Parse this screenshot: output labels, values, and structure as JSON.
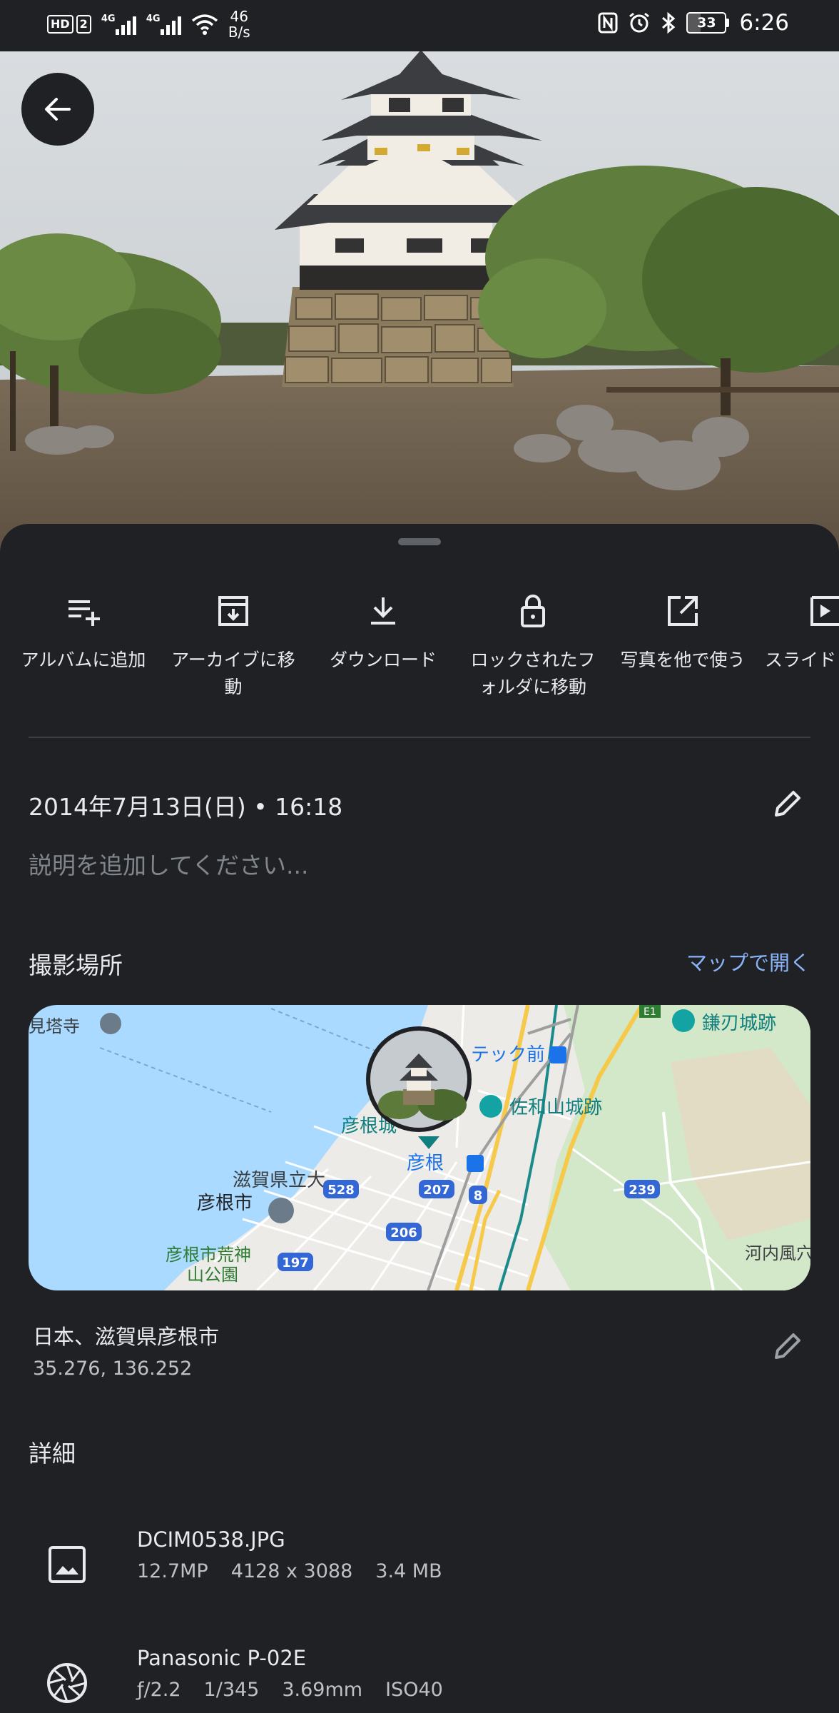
{
  "status_bar": {
    "hd_label": "HD",
    "sim_label": "2",
    "signal1_label": "4G",
    "signal2_label": "4G",
    "speed_value": "46",
    "speed_unit": "B/s",
    "battery": "33",
    "battery_level": 0.33,
    "time": "6:26"
  },
  "back_button": {
    "icon": "arrow-left-icon"
  },
  "actions": [
    {
      "label": "アルバムに追加",
      "icon": "playlist-add-icon"
    },
    {
      "label": "アーカイブに移\n動",
      "icon": "archive-icon"
    },
    {
      "label": "ダウンロード",
      "icon": "download-icon"
    },
    {
      "label": "ロックされたフ\nォルダに移動",
      "icon": "lock-icon"
    },
    {
      "label": "写真を他で使う",
      "icon": "open-external-icon"
    },
    {
      "label": "スライド",
      "icon": "slideshow-icon"
    }
  ],
  "info": {
    "datetime": "2014年7月13日(日) • 16:18",
    "description_placeholder": "説明を追加してください..."
  },
  "location": {
    "title": "撮影場所",
    "open_map": "マップで開く",
    "place": "日本、滋賀県彦根市",
    "coords": "35.276, 136.252"
  },
  "map": {
    "labels": {
      "temple": "見塔寺",
      "station_1": "テック前",
      "castle_ruin": "鎌刃城跡",
      "sawayama": "佐和山城跡",
      "castle": "彦根城",
      "hikone": "彦根",
      "university": "滋賀県立大",
      "city": "彦根市",
      "park_1": "彦根市荒神",
      "park_2": "山公園",
      "kawachi": "河内風穴",
      "route_e1": "E1"
    },
    "routes": [
      "528",
      "207",
      "8",
      "206",
      "197",
      "239"
    ]
  },
  "details": {
    "title": "詳細",
    "file": {
      "name": "DCIM0538.JPG",
      "megapixels": "12.7MP",
      "resolution": "4128 x 3088",
      "size": "3.4 MB"
    },
    "camera": {
      "model": "Panasonic P-02E",
      "aperture": "ƒ/2.2",
      "shutter": "1/345",
      "focal": "3.69mm",
      "iso": "ISO40"
    }
  },
  "colors": {
    "background": "#202124",
    "accent": "#8ab4f8",
    "water": "#aadaff"
  }
}
